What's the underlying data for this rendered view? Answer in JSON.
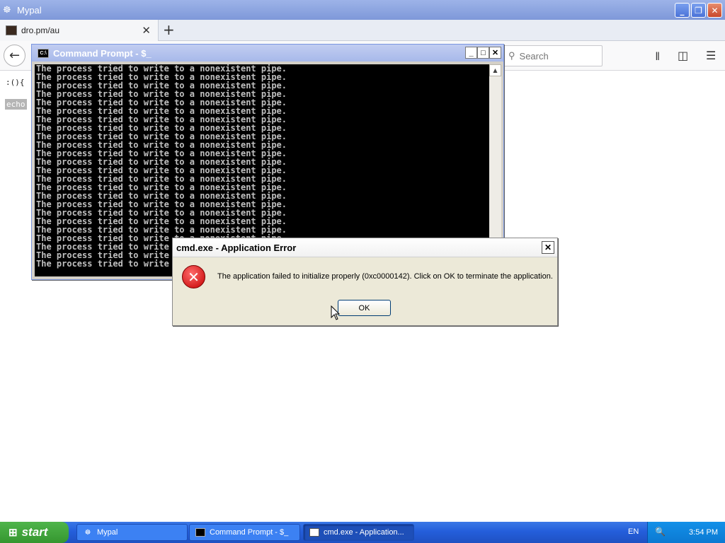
{
  "browser": {
    "title": "Mypal",
    "tab_title": "dro.pm/au",
    "new_tab": "+",
    "tab_close": "✕",
    "back": "←",
    "search_placeholder": "Search",
    "page_code": ":(){",
    "page_echo": "echo"
  },
  "cmd": {
    "title": "Command Prompt - $_",
    "icon_text": "C:\\",
    "console_line": "The process tried to write to a nonexistent pipe.",
    "line_count": 24
  },
  "dialog": {
    "title": "cmd.exe - Application Error",
    "message": "The application failed to initialize properly (0xc0000142). Click on OK to terminate the application.",
    "ok_label": "OK",
    "close": "✕"
  },
  "taskbar": {
    "start_label": "start",
    "items": [
      {
        "label": "Mypal"
      },
      {
        "label": "Command Prompt - $_"
      },
      {
        "label": "cmd.exe - Application..."
      }
    ],
    "language": "EN",
    "clock": "3:54 PM"
  },
  "colors": {
    "taskbar_blue": "#245edb",
    "start_green": "#35962f",
    "console_bg": "#000000",
    "console_text": "#c0c0c0"
  }
}
